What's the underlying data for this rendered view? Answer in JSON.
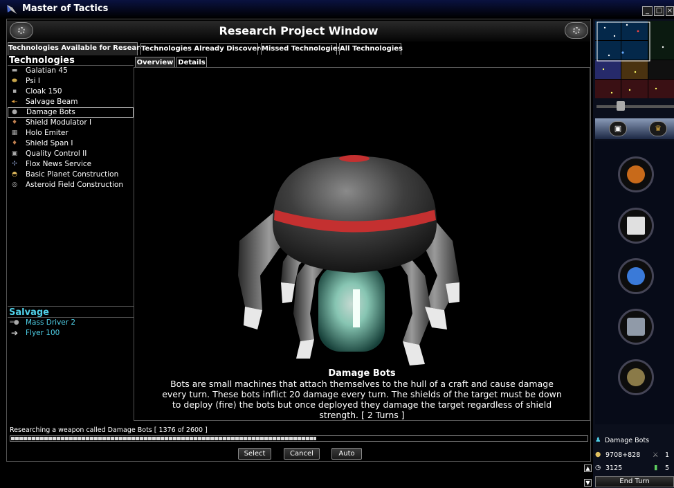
{
  "window": {
    "title": "Master of Tactics"
  },
  "header": {
    "title": "Research Project Window"
  },
  "tabs": [
    {
      "label": "Technologies Available for Research"
    },
    {
      "label": "Technologies Already Discovered"
    },
    {
      "label": "Missed Technologies"
    },
    {
      "label": "All Technologies"
    }
  ],
  "sub_tabs": [
    {
      "label": "Overview"
    },
    {
      "label": "Details"
    }
  ],
  "technologies": {
    "title": "Technologies",
    "items": [
      {
        "label": "Galatian 45",
        "icon": "gun-icon"
      },
      {
        "label": "Psi I",
        "icon": "disc-icon"
      },
      {
        "label": "Cloak 150",
        "icon": "cloak-icon"
      },
      {
        "label": "Salvage Beam",
        "icon": "beam-icon"
      },
      {
        "label": "Damage Bots",
        "icon": "bot-icon"
      },
      {
        "label": "Shield Modulator I",
        "icon": "shield-icon"
      },
      {
        "label": "Holo Emiter",
        "icon": "holo-icon"
      },
      {
        "label": "Shield Span I",
        "icon": "shield-span-icon"
      },
      {
        "label": "Quality Control II",
        "icon": "quality-icon"
      },
      {
        "label": "Flox News Service",
        "icon": "news-icon"
      },
      {
        "label": "Basic Planet Construction",
        "icon": "planet-icon"
      },
      {
        "label": "Asteroid Field Construction",
        "icon": "asteroid-icon"
      }
    ]
  },
  "salvage": {
    "title": "Salvage",
    "items": [
      {
        "label": "Mass Driver 2",
        "icon": "mass-driver-icon"
      },
      {
        "label": "Flyer 100",
        "icon": "flyer-icon"
      }
    ]
  },
  "selected": {
    "name": "Damage Bots",
    "description": "Bots are small machines that attach themselves to the hull of a craft and cause damage every turn. These bots inflict 20 damage every turn. The shields of the target must be down to deploy (fire) the bots but once deployed they damage the target regardless of shield strength. [ 2 Turns ]"
  },
  "status": {
    "text": "Researching a weapon called Damage Bots [ 1376 of 2600 ]",
    "progress": 0.529
  },
  "buttons": {
    "select": "Select",
    "cancel": "Cancel",
    "auto": "Auto"
  },
  "side": {
    "current_research": "Damage Bots",
    "credits": "9708+828",
    "stat_1": "1",
    "time": "3125",
    "stat_2": "5",
    "end_turn": "End Turn"
  },
  "colors": {
    "accent_cyan": "#4fd0e8",
    "bot_red": "#c43030"
  }
}
